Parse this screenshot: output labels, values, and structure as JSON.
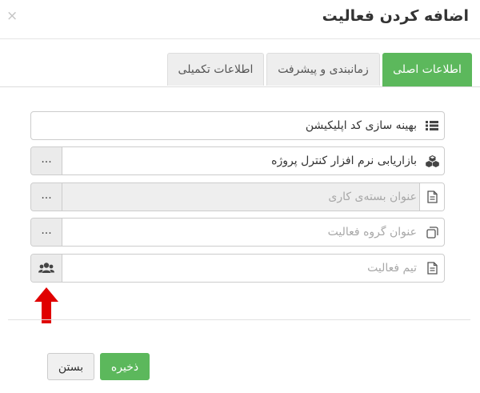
{
  "dialog": {
    "title": "اضافه کردن فعالیت",
    "close_label": "×"
  },
  "tabs": [
    {
      "label": "اطلاعات اصلی",
      "active": true
    },
    {
      "label": "زمانبندی و پیشرفت",
      "active": false
    },
    {
      "label": "اطلاعات تکمیلی",
      "active": false
    }
  ],
  "fields": {
    "activity_name": {
      "value": "بهینه سازی کد اپلیکیشن",
      "icon": "list-icon"
    },
    "project": {
      "value": "بازاریابی نرم افزار کنترل پروژه",
      "icon": "cubes-icon",
      "button_label": "..."
    },
    "work_package": {
      "placeholder": "عنوان بسته‌ی کاری",
      "icon": "file-icon",
      "button_label": "...",
      "disabled": true
    },
    "activity_group": {
      "placeholder": "عنوان گروه فعالیت",
      "icon": "copy-icon",
      "button_label": "..."
    },
    "team": {
      "placeholder": "تیم فعالیت",
      "icon": "file-icon",
      "button_icon": "users-icon"
    }
  },
  "footer": {
    "save_label": "ذخیره",
    "close_label": "بستن"
  },
  "colors": {
    "accent": "#5cb85c",
    "annotation_arrow": "#e00000"
  }
}
